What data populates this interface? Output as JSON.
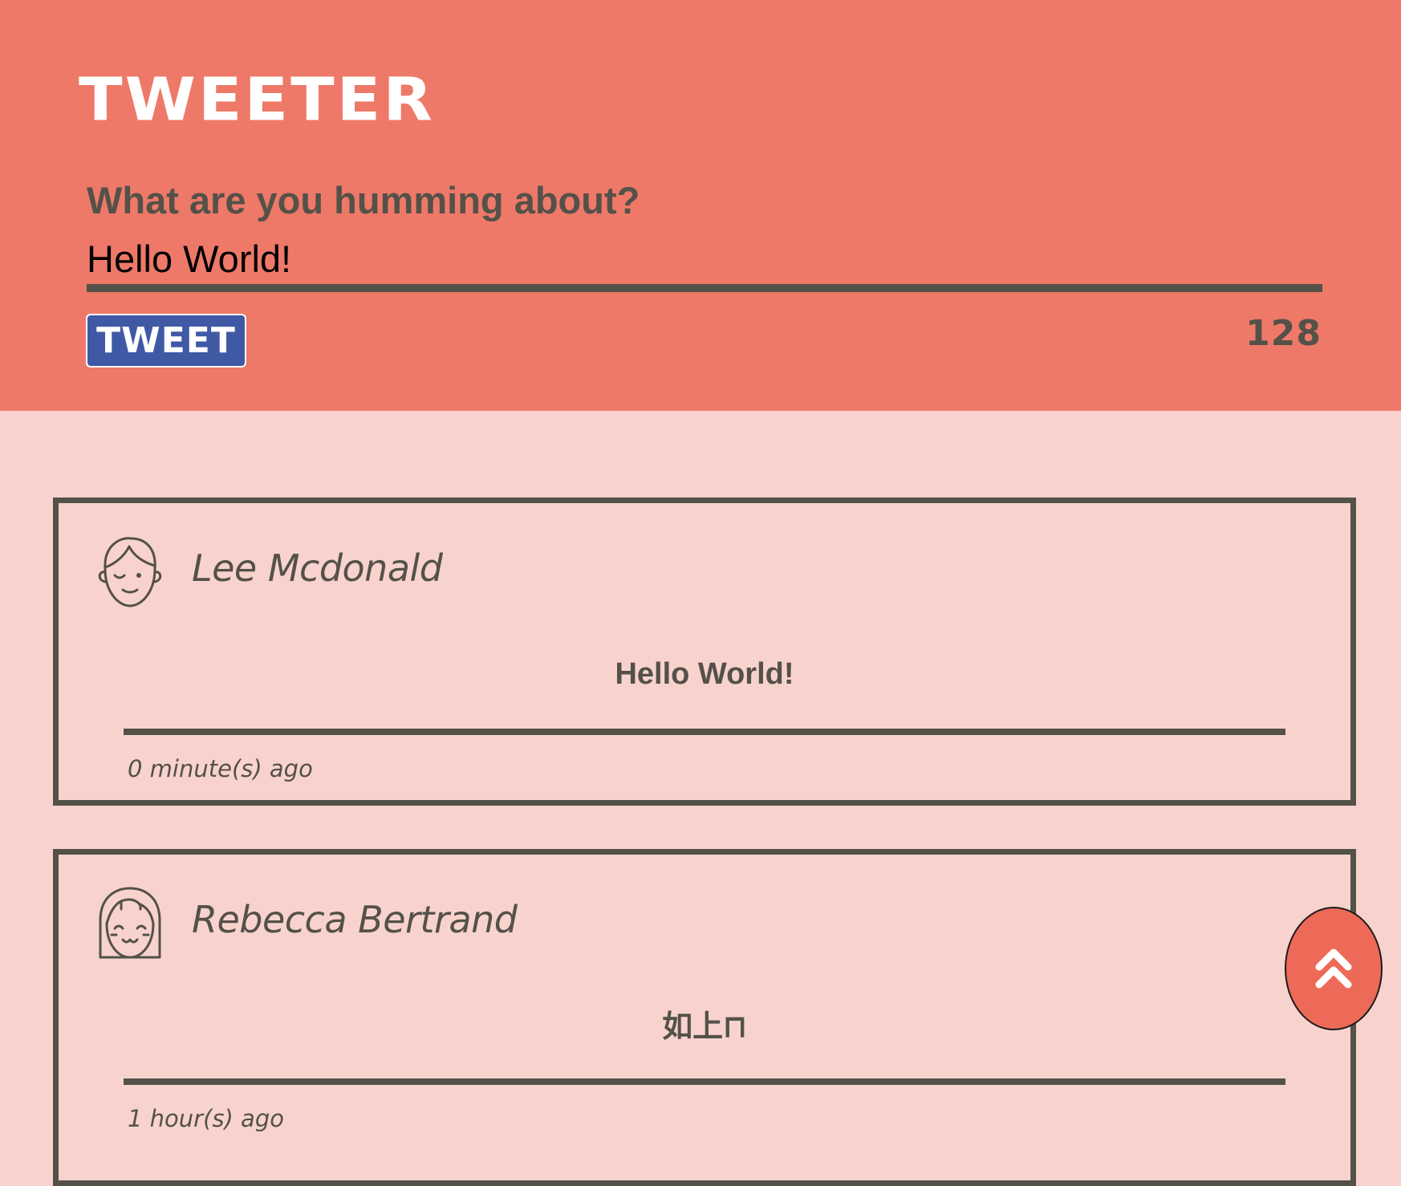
{
  "app": {
    "title": "TWEETER"
  },
  "compose": {
    "label": "What are you humming about?",
    "input_value": "Hello World!",
    "submit_label": "TWEET",
    "char_counter": "128"
  },
  "tweets": [
    {
      "author": "Lee Mcdonald",
      "avatar_icon": "boy-face-avatar-icon",
      "content": "Hello World!",
      "time": "0 minute(s) ago"
    },
    {
      "author": "Rebecca Bertrand",
      "avatar_icon": "girl-face-avatar-icon",
      "content": "如上⊓",
      "time": "1 hour(s) ago"
    }
  ],
  "scroll_top": {
    "icon": "double-chevron-up-icon"
  },
  "colors": {
    "header_bg": "#ee7968",
    "page_bg": "#f8d3cd",
    "text_dark": "#545149",
    "button_bg": "#4059a5",
    "scroll_button_bg": "#ee6a58"
  }
}
